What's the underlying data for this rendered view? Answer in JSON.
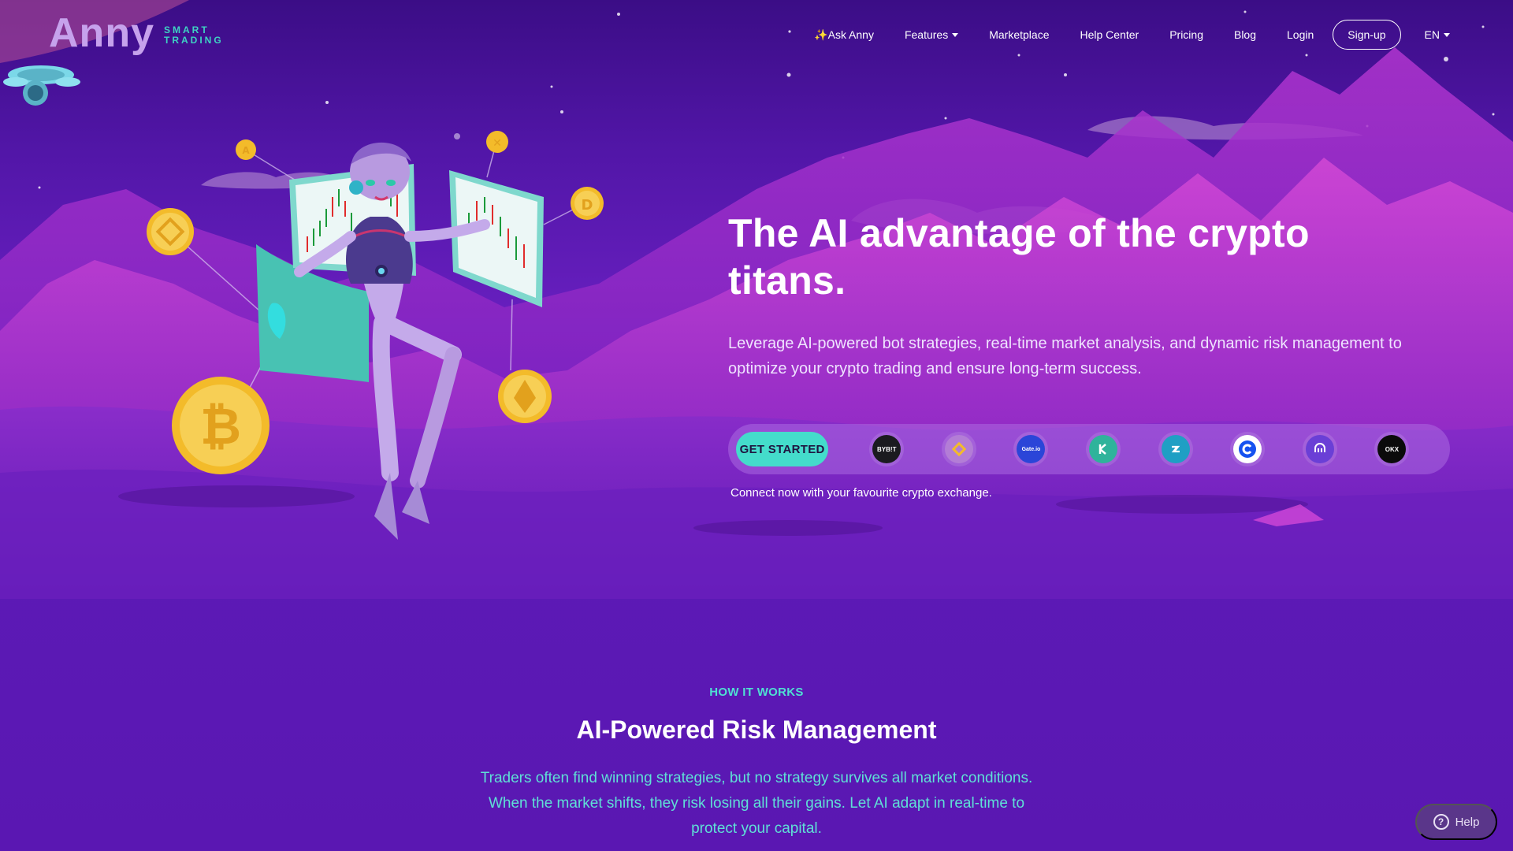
{
  "brand": {
    "logo_main": "Anny",
    "logo_sub": "SMART TRADING"
  },
  "nav": {
    "items": [
      {
        "label": "✨Ask Anny",
        "has_dropdown": false
      },
      {
        "label": "Features",
        "has_dropdown": true
      },
      {
        "label": "Marketplace",
        "has_dropdown": false
      },
      {
        "label": "Help Center",
        "has_dropdown": false
      },
      {
        "label": "Pricing",
        "has_dropdown": false
      },
      {
        "label": "Blog",
        "has_dropdown": false
      },
      {
        "label": "Login",
        "has_dropdown": false
      }
    ],
    "signup_label": "Sign-up",
    "language": "EN"
  },
  "hero": {
    "title": "The AI advantage of the crypto titans.",
    "description": "Leverage AI-powered bot strategies, real-time market analysis, and dynamic risk management to optimize your crypto trading and ensure long-term success.",
    "cta_label": "GET STARTED",
    "exchanges": [
      {
        "icon": "bybit-icon",
        "text": "BYB!T",
        "color": "#1b1b1f"
      },
      {
        "icon": "binance-icon",
        "text": "",
        "color": "#b37dd6"
      },
      {
        "icon": "gateio-icon",
        "text": "Gate.io",
        "color": "#2b45d8"
      },
      {
        "icon": "kucoin-icon",
        "text": "",
        "color": "#2fb39b"
      },
      {
        "icon": "bitget-icon",
        "text": "",
        "color": "#1f9fc4"
      },
      {
        "icon": "coinbase-icon",
        "text": "",
        "color": "#1652f0"
      },
      {
        "icon": "kraken-icon",
        "text": "",
        "color": "#6a3fd6"
      },
      {
        "icon": "okx-icon",
        "text": "OKX",
        "color": "#0b0b0b"
      }
    ],
    "exchange_caption": "Connect now with your favourite crypto exchange."
  },
  "how_it_works": {
    "label": "HOW IT WORKS",
    "title": "AI-Powered Risk Management",
    "description": "Traders often find winning strategies, but no strategy survives all market conditions. When the market shifts, they risk losing all their gains. Let AI adapt in real-time to protect your capital."
  },
  "help_widget": {
    "label": "Help"
  },
  "colors": {
    "accent_teal": "#44dccb",
    "background_purple": "#5a19b3",
    "logo_purple": "#c6a2ec",
    "coin_gold": "#f3bb2a"
  }
}
